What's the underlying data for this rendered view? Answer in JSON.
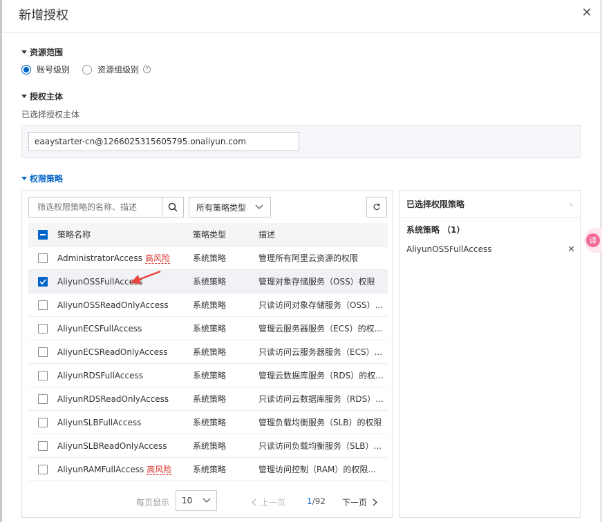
{
  "dialog": {
    "title": "新增授权",
    "close_icon": "close-icon"
  },
  "resource_scope": {
    "heading": "资源范围",
    "options": [
      {
        "label": "账号级别",
        "selected": true
      },
      {
        "label": "资源组级别",
        "selected": false
      }
    ]
  },
  "principal": {
    "heading": "授权主体",
    "selected_label": "已选择授权主体",
    "value": "eaaystarter-cn@1266025315605795.onaliyun.com"
  },
  "policies": {
    "heading": "权限策略",
    "search_placeholder": "筛选权限策略的名称、描述",
    "type_filter": "所有策略类型",
    "columns": [
      "策略名称",
      "策略类型",
      "描述"
    ],
    "risk_label": "高风险",
    "rows": [
      {
        "name": "AdministratorAccess",
        "risk": true,
        "type": "系统策略",
        "desc": "管理所有阿里云资源的权限",
        "checked": false
      },
      {
        "name": "AliyunOSSFullAccess",
        "risk": false,
        "type": "系统策略",
        "desc": "管理对象存储服务（OSS）权限",
        "checked": true
      },
      {
        "name": "AliyunOSSReadOnlyAccess",
        "risk": false,
        "type": "系统策略",
        "desc": "只读访问对象存储服务（OSS）...",
        "checked": false
      },
      {
        "name": "AliyunECSFullAccess",
        "risk": false,
        "type": "系统策略",
        "desc": "管理云服务器服务（ECS）的权...",
        "checked": false
      },
      {
        "name": "AliyunECSReadOnlyAccess",
        "risk": false,
        "type": "系统策略",
        "desc": "只读访问云服务器服务（ECS）...",
        "checked": false
      },
      {
        "name": "AliyunRDSFullAccess",
        "risk": false,
        "type": "系统策略",
        "desc": "管理云数据库服务（RDS）的权...",
        "checked": false
      },
      {
        "name": "AliyunRDSReadOnlyAccess",
        "risk": false,
        "type": "系统策略",
        "desc": "只读访问云数据库服务（RDS）...",
        "checked": false
      },
      {
        "name": "AliyunSLBFullAccess",
        "risk": false,
        "type": "系统策略",
        "desc": "管理负载均衡服务（SLB）的权限",
        "checked": false
      },
      {
        "name": "AliyunSLBReadOnlyAccess",
        "risk": false,
        "type": "系统策略",
        "desc": "只读访问负载均衡服务（SLB）...",
        "checked": false
      },
      {
        "name": "AliyunRAMFullAccess",
        "risk": true,
        "type": "系统策略",
        "desc": "管理访问控制（RAM）的权限...",
        "checked": false
      }
    ],
    "pager": {
      "per_page_label": "每页显示",
      "per_page": "10",
      "prev": "上一页",
      "current": "1",
      "total": "/92",
      "next": "下一页"
    }
  },
  "selected_policies": {
    "heading": "已选择权限策略",
    "group": "系统策略 （1）",
    "items": [
      "AliyunOSSFullAccess"
    ]
  },
  "translate_badge": "译",
  "colors": {
    "accent": "#0064c8",
    "risk": "#d93026",
    "annotation_arrow": "#e8453c"
  }
}
